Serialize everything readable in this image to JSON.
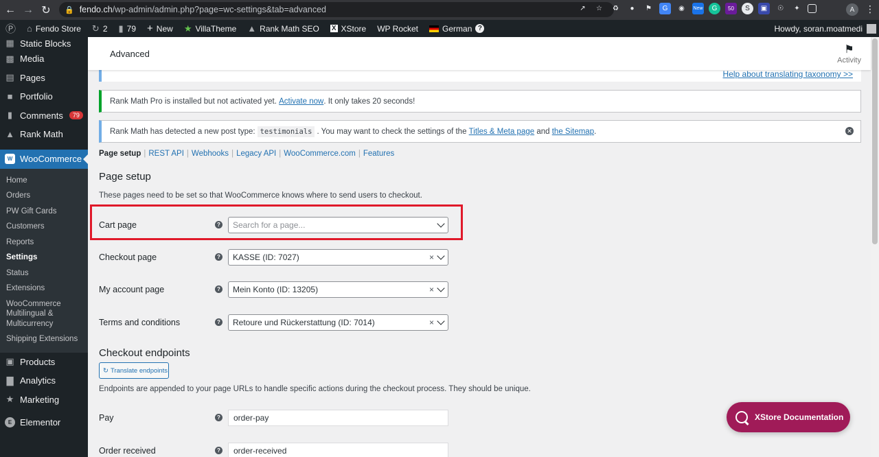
{
  "browser": {
    "url_host": "fendo.ch",
    "url_path": "/wp-admin/admin.php?page=wc-settings&tab=advanced",
    "profile_initial": "A"
  },
  "adminbar": {
    "site_name": "Fendo Store",
    "updates_count": "2",
    "comments_count": "79",
    "new_label": "New",
    "villatheme_label": "VillaTheme",
    "rankmath_label": "Rank Math SEO",
    "xstore_label": "XStore",
    "wprocket_label": "WP Rocket",
    "language_label": "German",
    "greeting": "Howdy, soran.moatmedi"
  },
  "sidebar": {
    "items_top": [
      {
        "label": "Static Blocks",
        "icon": "static-blocks-icon"
      },
      {
        "label": "Media",
        "icon": "media-icon"
      },
      {
        "label": "Pages",
        "icon": "pages-icon"
      },
      {
        "label": "Portfolio",
        "icon": "portfolio-icon"
      },
      {
        "label": "Comments",
        "icon": "comments-icon",
        "badge": "79"
      },
      {
        "label": "Rank Math",
        "icon": "rank-math-icon"
      }
    ],
    "woocommerce_label": "WooCommerce",
    "submenu": [
      "Home",
      "Orders",
      "PW Gift Cards",
      "Customers",
      "Reports",
      "Settings",
      "Status",
      "Extensions",
      "WooCommerce Multilingual & Multicurrency",
      "Shipping Extensions"
    ],
    "active_submenu": "Settings",
    "items_bottom": [
      {
        "label": "Products",
        "icon": "products-icon"
      },
      {
        "label": "Analytics",
        "icon": "analytics-icon"
      },
      {
        "label": "Marketing",
        "icon": "marketing-icon"
      },
      {
        "label": "Elementor",
        "icon": "elementor-icon"
      }
    ]
  },
  "header": {
    "title": "Advanced",
    "activity_label": "Activity"
  },
  "partial_notice_link": "Help about translating taxonomy >>",
  "notices": {
    "rankmath_pro": {
      "text_before": "Rank Math Pro is installed but not activated yet. ",
      "link": "Activate now",
      "text_after": ". It only takes 20 seconds!"
    },
    "post_type": {
      "text_before": "Rank Math has detected a new post type: ",
      "code": "testimonials",
      "text_mid": ". You may want to check the settings of the ",
      "link1": "Titles & Meta page",
      "text_and": " and ",
      "link2": "the Sitemap",
      "text_end": "."
    }
  },
  "subnav": [
    {
      "label": "Page setup",
      "current": true
    },
    {
      "label": "REST API"
    },
    {
      "label": "Webhooks"
    },
    {
      "label": "Legacy API"
    },
    {
      "label": "WooCommerce.com"
    },
    {
      "label": "Features"
    }
  ],
  "page_setup": {
    "heading": "Page setup",
    "description": "These pages need to be set so that WooCommerce knows where to send users to checkout.",
    "fields": [
      {
        "label": "Cart page",
        "placeholder": "Search for a page...",
        "value": ""
      },
      {
        "label": "Checkout page",
        "value": "KASSE (ID: 7027)"
      },
      {
        "label": "My account page",
        "value": "Mein Konto (ID: 13205)"
      },
      {
        "label": "Terms and conditions",
        "value": "Retoure und Rückerstattung (ID: 7014)"
      }
    ]
  },
  "checkout_endpoints": {
    "heading": "Checkout endpoints",
    "translate_button": "Translate endpoints",
    "description": "Endpoints are appended to your page URLs to handle specific actions during the checkout process. They should be unique.",
    "fields": [
      {
        "label": "Pay",
        "value": "order-pay"
      },
      {
        "label": "Order received",
        "value": "order-received"
      }
    ]
  },
  "xstore_doc_button": "XStore Documentation",
  "colors": {
    "wp_blue": "#2271b1",
    "admin_dark": "#1d2327",
    "highlight_red": "#e0192a",
    "xstore_magenta": "#a01b58"
  }
}
